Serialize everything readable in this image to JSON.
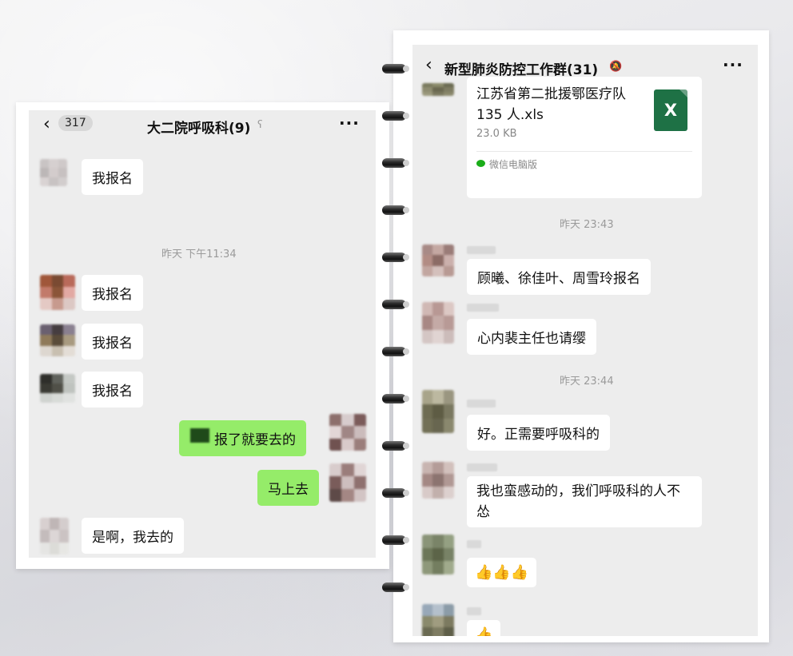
{
  "left_chat": {
    "back_badge": "317",
    "title": "大二院呼吸科(9)",
    "mute_icon": "ear-mute-icon",
    "more": "···",
    "timestamp": "昨天 下午11:34",
    "messages": [
      {
        "from": "other",
        "text": "我报名"
      },
      {
        "from": "other",
        "text": "我报名"
      },
      {
        "from": "other",
        "text": "我报名"
      },
      {
        "from": "other",
        "text": "我报名"
      },
      {
        "from": "me",
        "text": "报了就要去的"
      },
      {
        "from": "me",
        "text": "马上去"
      },
      {
        "from": "other",
        "text": "是啊，我去的"
      }
    ]
  },
  "right_chat": {
    "title": "新型肺炎防控工作群(31)",
    "mute_icon": "bell-mute-icon",
    "more": "···",
    "file": {
      "name_line1": "江苏省第二批援鄂医疗队",
      "name_line2": "135 人.xls",
      "size": "23.0 KB",
      "icon_letter": "X",
      "source": "微信电脑版"
    },
    "timestamp1": "昨天 23:43",
    "timestamp2": "昨天 23:44",
    "messages": [
      {
        "text": "顾曦、徐佳叶、周雪玲报名"
      },
      {
        "text": "心内裴主任也请缨"
      },
      {
        "text": "好。正需要呼吸科的"
      },
      {
        "text_line1": "我也蛮感动的，我们呼吸科的人不",
        "text_line2": "怂"
      },
      {
        "text": "👍👍👍"
      },
      {
        "text": "👍"
      }
    ]
  },
  "colors": {
    "chat_bg": "#ededed",
    "bubble_other": "#ffffff",
    "bubble_me": "#95ec69",
    "excel_green": "#1e7145"
  }
}
